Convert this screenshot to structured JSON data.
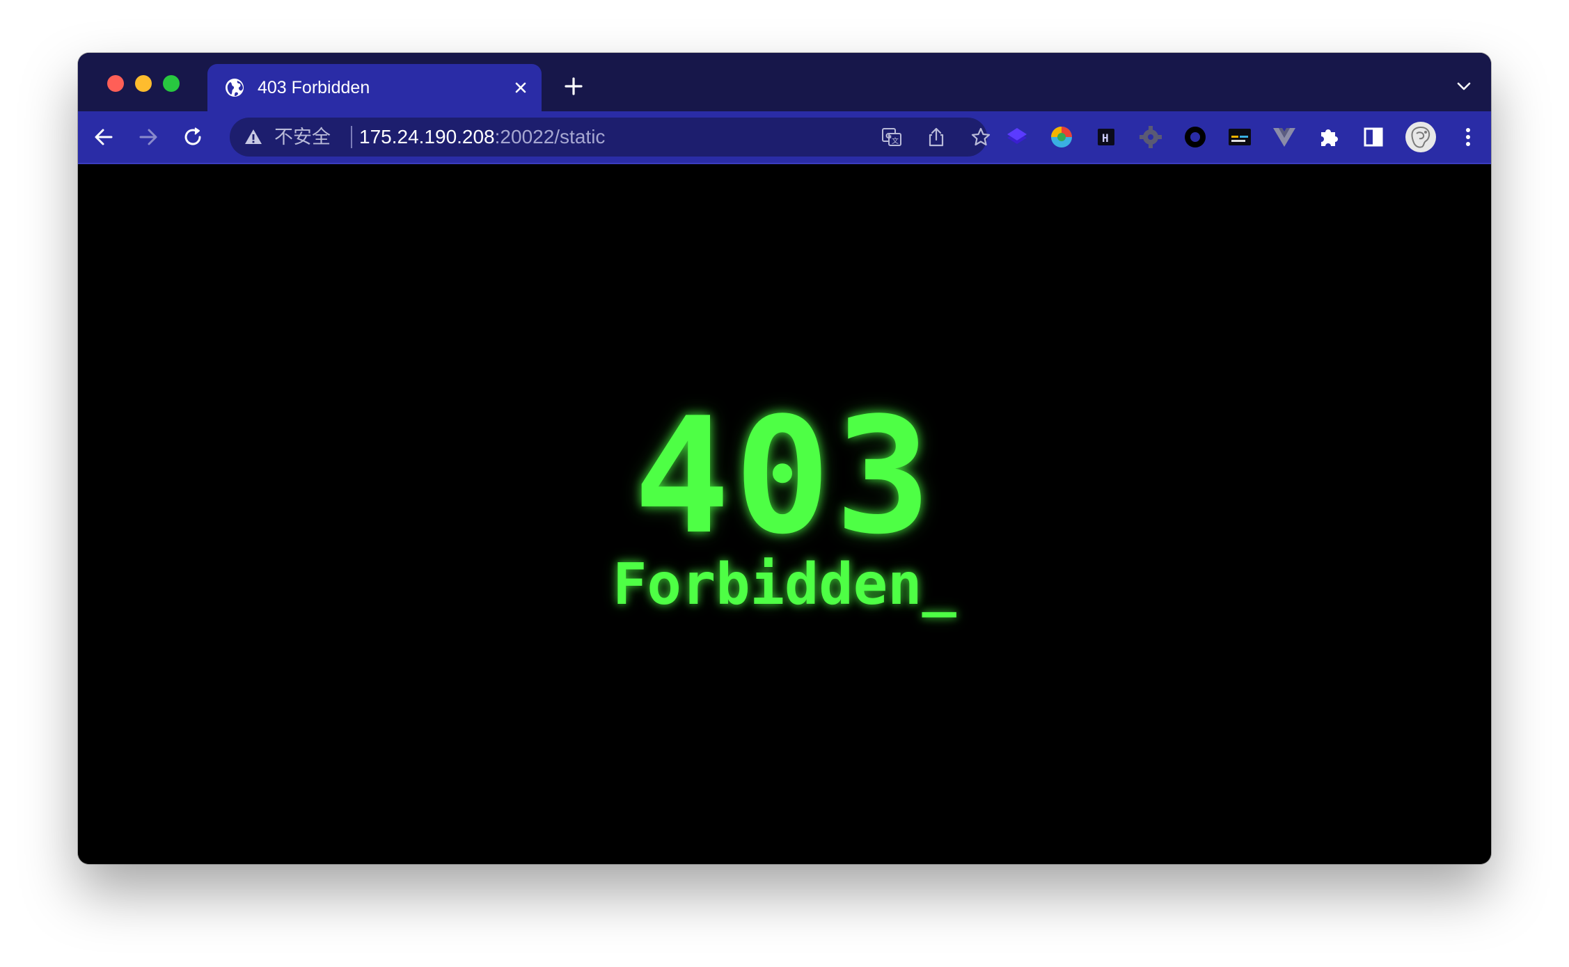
{
  "tab": {
    "title": "403 Forbidden",
    "favicon": "globe-icon"
  },
  "toolbar": {
    "security_label": "不安全",
    "url_host": "175.24.190.208",
    "url_rest": ":20022/static",
    "omnibox_icons": [
      "translate-icon",
      "share-icon",
      "bookmark-star-icon"
    ],
    "extensions": [
      "layers-extension-icon",
      "colorful-extension-icon",
      "h-extension-icon",
      "gear-extension-icon",
      "circle-extension-icon",
      "terminal-extension-icon",
      "vue-extension-icon",
      "puzzle-icon",
      "sidepanel-icon",
      "profile-avatar",
      "menu-kebab-icon"
    ]
  },
  "page": {
    "code": "403",
    "message": "Forbidden_"
  },
  "colors": {
    "tab_strip": "#17174a",
    "toolbar": "#2a2ca6",
    "omnibox": "#1d1e6e",
    "page_background": "#000000",
    "terminal_green": "#4eff45"
  }
}
